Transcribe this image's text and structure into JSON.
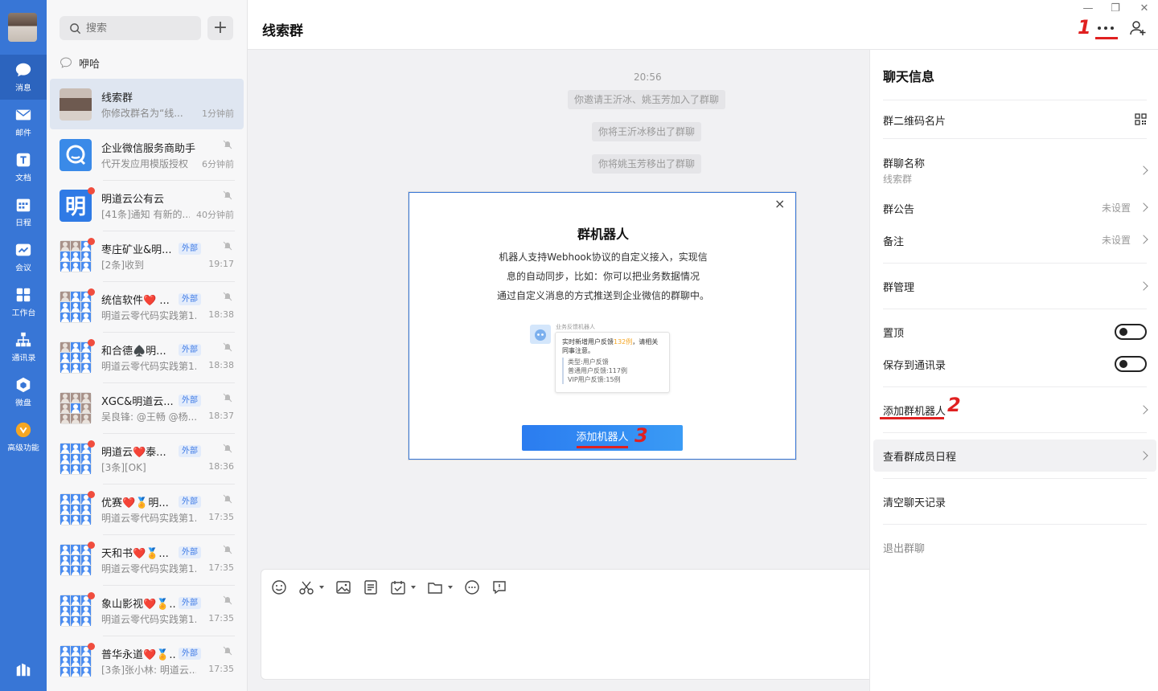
{
  "rail": {
    "items": [
      {
        "label": "消息"
      },
      {
        "label": "邮件"
      },
      {
        "label": "文档"
      },
      {
        "label": "日程"
      },
      {
        "label": "会议"
      },
      {
        "label": "工作台"
      },
      {
        "label": "通讯录"
      },
      {
        "label": "微盘"
      },
      {
        "label": "高级功能"
      }
    ]
  },
  "list": {
    "search_placeholder": "搜索",
    "add_label": "+",
    "pinned_label": "咿哈",
    "tag_external": "外部",
    "conversations": [
      {
        "name": "线索群",
        "preview": "你修改群名为“线...",
        "time": "1分钟前"
      },
      {
        "name": "企业微信服务商助手",
        "preview": "代开发应用模版授权",
        "time": "6分钟前"
      },
      {
        "name": "明道云公有云",
        "preview": "[41条]通知 有新的...",
        "time": "40分钟前"
      },
      {
        "name": "枣庄矿业&明...",
        "preview": "[2条]收到",
        "time": "19:17"
      },
      {
        "name": "统信软件❤️ ...",
        "preview": "明道云零代码实践第1...",
        "time": "18:38"
      },
      {
        "name": "和合德♠️明...",
        "preview": "明道云零代码实践第1...",
        "time": "18:38"
      },
      {
        "name": "XGC&明道云...",
        "preview": "吴良锋: @王畅  @杨...",
        "time": "18:37"
      },
      {
        "name": "明道云❤️泰...",
        "preview": "[3条][OK]",
        "time": "18:36"
      },
      {
        "name": "优赛❤️🏅明...",
        "preview": "明道云零代码实践第1...",
        "time": "17:35"
      },
      {
        "name": "天和书❤️🏅...",
        "preview": "明道云零代码实践第1...",
        "time": "17:35"
      },
      {
        "name": "象山影视❤️🏅...",
        "preview": "明道云零代码实践第1...",
        "time": "17:35"
      },
      {
        "name": "普华永道❤️🏅...",
        "preview": "[3条]张小林: 明道云...",
        "time": "17:35"
      }
    ]
  },
  "chat": {
    "title": "线索群",
    "timestamp": "20:56",
    "system_messages": [
      "你邀请王沂冰、姚玉芳加入了群聊",
      "你将王沂冰移出了群聊",
      "你将姚玉芳移出了群聊"
    ]
  },
  "annotations": {
    "step1": "1",
    "step2": "2",
    "step3": "3"
  },
  "modal": {
    "title": "群机器人",
    "desc_line1": "机器人支持Webhook协议的自定义接入，实现信",
    "desc_line2": "息的自动同步，比如：你可以把业务数据情况",
    "desc_line3": "通过自定义消息的方式推送到企业微信的群聊中。",
    "preview": {
      "bot_name": "业务反馈机器人",
      "line1_a": "实时新增用户反馈",
      "line1_hl": "132例",
      "line1_b": "，请相关",
      "line2": "同事注意。",
      "sub1": "类型:用户反馈",
      "sub2": "普通用户反馈:117例",
      "sub3": "VIP用户反馈:15例"
    },
    "button": "添加机器人",
    "close": "×"
  },
  "panel": {
    "title": "聊天信息",
    "qr_label": "群二维码名片",
    "group_name_label": "群聊名称",
    "group_name_value": "线索群",
    "notice_label": "群公告",
    "notice_value": "未设置",
    "remark_label": "备注",
    "remark_value": "未设置",
    "manage_label": "群管理",
    "pin_label": "置顶",
    "save_contacts_label": "保存到通讯录",
    "add_bot_label": "添加群机器人",
    "schedule_label": "查看群成员日程",
    "clear_label": "清空聊天记录",
    "exit_label": "退出群聊"
  }
}
